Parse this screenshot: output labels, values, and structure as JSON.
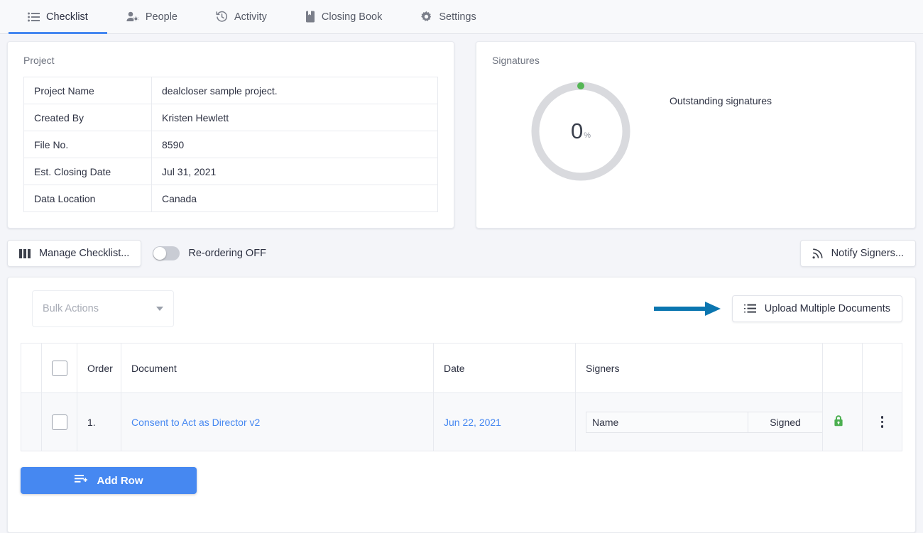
{
  "tabs": [
    {
      "label": "Checklist",
      "icon": "list-icon",
      "active": true
    },
    {
      "label": "People",
      "icon": "people-gear-icon",
      "active": false
    },
    {
      "label": "Activity",
      "icon": "history-icon",
      "active": false
    },
    {
      "label": "Closing Book",
      "icon": "book-icon",
      "active": false
    },
    {
      "label": "Settings",
      "icon": "gear-icon",
      "active": false
    }
  ],
  "project": {
    "title": "Project",
    "rows": [
      {
        "key": "Project Name",
        "value": "dealcloser sample project."
      },
      {
        "key": "Created By",
        "value": "Kristen Hewlett"
      },
      {
        "key": "File No.",
        "value": "8590"
      },
      {
        "key": "Est. Closing Date",
        "value": "Jul 31, 2021"
      },
      {
        "key": "Data Location",
        "value": "Canada"
      }
    ]
  },
  "signatures": {
    "title": "Signatures",
    "percent": "0",
    "percent_symbol": "%",
    "legend": "Outstanding signatures",
    "ring_color": "#d9dade",
    "marker_color": "#55b655"
  },
  "toolbar": {
    "manage_checklist": "Manage Checklist...",
    "manage_icon": "columns-icon",
    "reordering_label": "Re-ordering OFF",
    "reordering_on": false,
    "notify_signers": "Notify Signers...",
    "notify_icon": "broadcast-icon"
  },
  "list": {
    "bulk_actions_placeholder": "Bulk Actions",
    "upload_button": "Upload Multiple Documents",
    "upload_icon": "ordered-list-icon",
    "annotation_arrow_color": "#0b76b0",
    "columns": [
      "Order",
      "Document",
      "Date",
      "Signers"
    ],
    "rows": [
      {
        "order": "1.",
        "document": "Consent to Act as Director v2",
        "date": "Jun 22, 2021",
        "signer_name_placeholder": "Name",
        "signed_label": "Signed",
        "lock_icon": "lock-icon",
        "lock_color": "#4caf50",
        "menu_icon": "kebab-menu-icon"
      }
    ],
    "add_row": "Add Row",
    "add_row_icon": "add-row-icon",
    "accent_color": "#4688f1"
  }
}
